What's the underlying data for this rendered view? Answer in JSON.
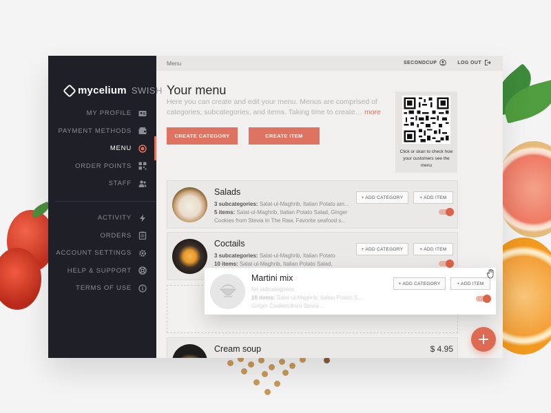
{
  "brand": {
    "name": "mycelium",
    "sub": "SWISH"
  },
  "sidebar": {
    "items": [
      {
        "label": "MY PROFILE",
        "icon": "id-card-icon"
      },
      {
        "label": "PAYMENT METHODS",
        "icon": "wallet-icon"
      },
      {
        "label": "MENU",
        "icon": "menu-target-icon",
        "active": true
      },
      {
        "label": "ORDER POINTS",
        "icon": "qr-code-icon"
      },
      {
        "label": "STAFF",
        "icon": "people-icon"
      }
    ],
    "secondary": [
      {
        "label": "ACTIVITY",
        "icon": "bolt-icon"
      },
      {
        "label": "ORDERS",
        "icon": "clipboard-icon"
      },
      {
        "label": "ACCOUNT SETTINGS",
        "icon": "gear-icon"
      },
      {
        "label": "HELP & SUPPORT",
        "icon": "lifebuoy-icon"
      },
      {
        "label": "TERMS OF USE",
        "icon": "info-icon"
      }
    ]
  },
  "topbar": {
    "breadcrumb": "Menu",
    "user": "SECONDCUP",
    "logout": "LOG OUT"
  },
  "page": {
    "title": "Your menu",
    "description": "Here you can create and edit your menu. Menus are comprised of categories, subcategories, and items. Taking time to create…",
    "more": "more",
    "create_category": "CREATE CATEGORY",
    "create_item": "CREATE ITEM"
  },
  "qr": {
    "caption": "Click or skan to check how your customers see the menu"
  },
  "actions": {
    "add_category": "+ ADD CATEGORY",
    "add_item": "+ ADD ITEM"
  },
  "categories": [
    {
      "name": "Salads",
      "sub_label": "3 subcategories:",
      "sub_text": "Salat-ul-Maghrib, Italian Potato am...",
      "items_label": "5 items:",
      "items_text": "Salat-ul-Maghrib, Italian Potato Salad, Ginger",
      "items_more": "Cookies from Stevia In The Raw, Favorite seafood s...",
      "enabled": true
    },
    {
      "name": "Coctails",
      "sub_label": "3 subcategories:",
      "sub_text": "Salat-ul-Maghrib, Italian Potato",
      "items_label": "10 items:",
      "items_text": "Salat-ul-Maghrib, Italian Potato Salad,",
      "enabled": true
    },
    {
      "name": "Cream soup",
      "price": "$ 4.95"
    }
  ],
  "dragging": {
    "name": "Martini mix",
    "sub_text": "No subcategories",
    "items_label": "10 items:",
    "items_text": "Salat-ul-Maghrib, Italian Potato S...",
    "items_more": "Ginger Cookies from Stevia ...",
    "enabled": true
  },
  "fab": {
    "label": "+"
  },
  "colors": {
    "accent": "#dd7360",
    "sidebar": "#1f1f27",
    "background": "#f1f0ef"
  }
}
